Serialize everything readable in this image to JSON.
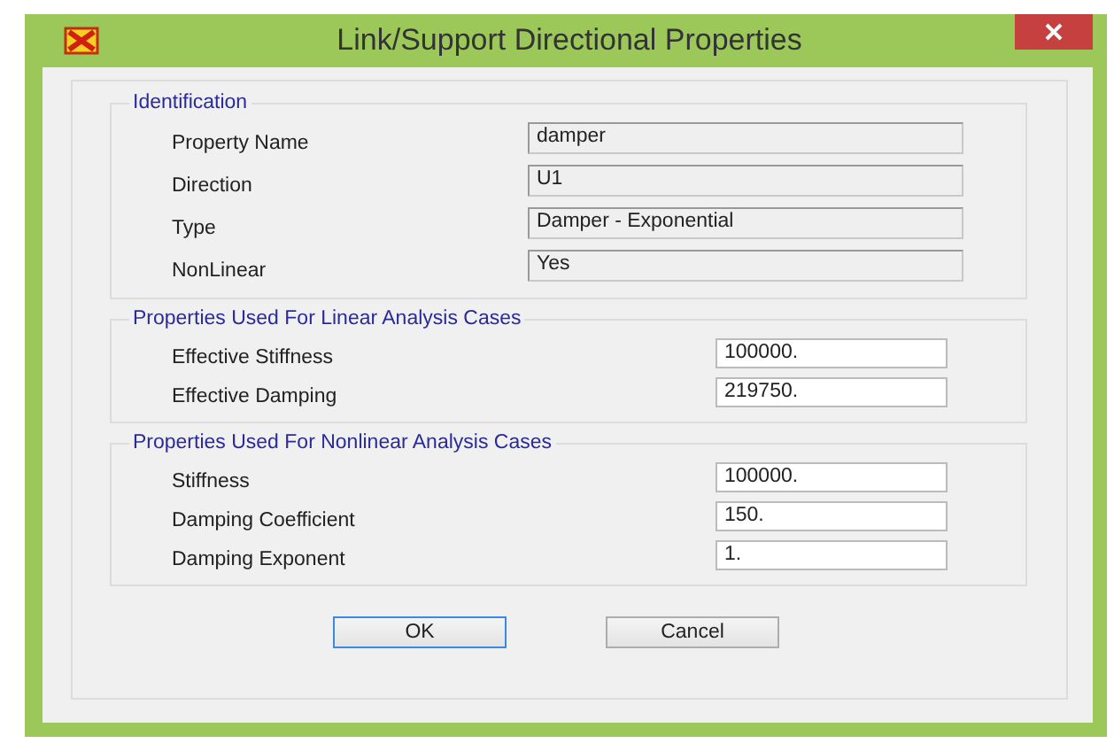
{
  "window": {
    "title": "Link/Support Directional Properties"
  },
  "identification": {
    "title": "Identification",
    "rows": [
      {
        "label": "Property Name",
        "value": "damper"
      },
      {
        "label": "Direction",
        "value": "U1"
      },
      {
        "label": "Type",
        "value": "Damper - Exponential"
      },
      {
        "label": "NonLinear",
        "value": "Yes"
      }
    ]
  },
  "groups": [
    {
      "title": "Properties Used For Linear Analysis Cases",
      "rows": [
        {
          "label": "Effective Stiffness",
          "value": "100000."
        },
        {
          "label": "Effective Damping",
          "value": "219750."
        }
      ]
    },
    {
      "title": "Properties Used For Nonlinear Analysis Cases",
      "rows": [
        {
          "label": "Stiffness",
          "value": "100000."
        },
        {
          "label": "Damping Coefficient",
          "value": "150."
        },
        {
          "label": "Damping Exponent",
          "value": "1."
        }
      ]
    }
  ],
  "buttons": [
    {
      "label": "OK",
      "default": true
    },
    {
      "label": "Cancel",
      "default": false
    }
  ]
}
